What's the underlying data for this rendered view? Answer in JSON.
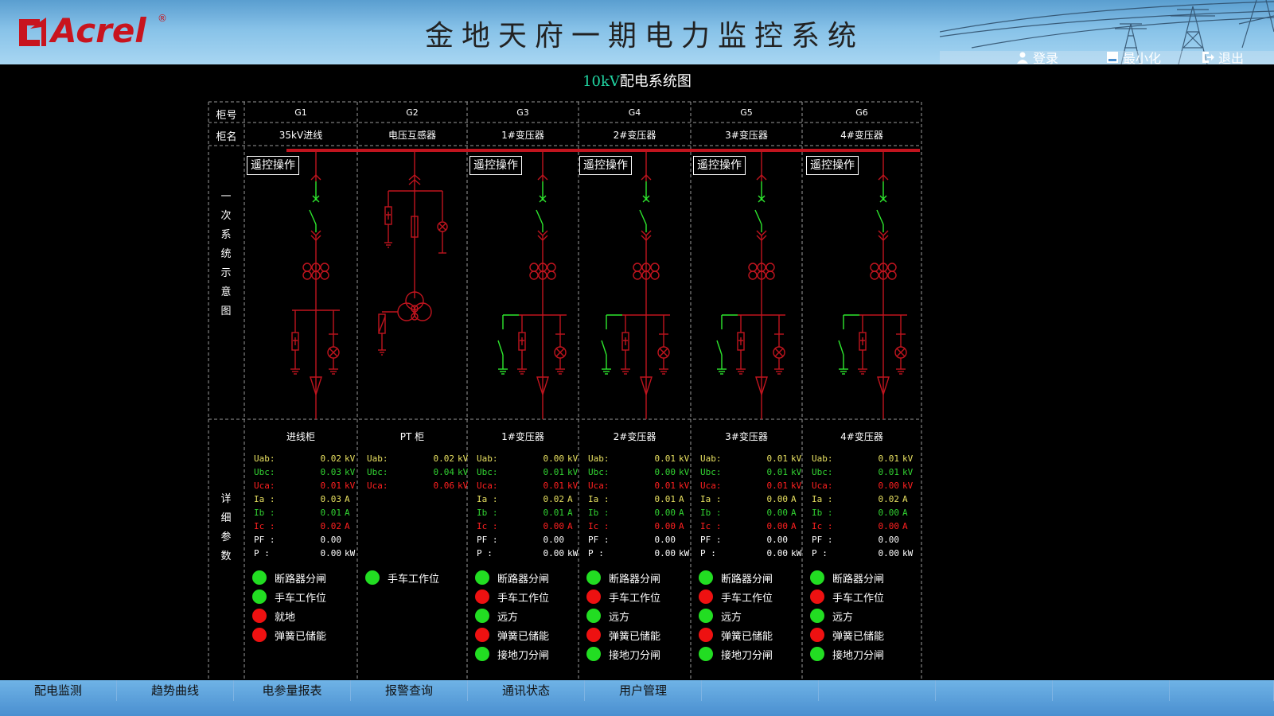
{
  "header": {
    "logo_text": "Acrel",
    "logo_mark": "®",
    "title": "金地天府一期电力监控系统",
    "buttons": [
      {
        "label": "登录",
        "icon": "user-icon"
      },
      {
        "label": "最小化",
        "icon": "minimize-icon"
      },
      {
        "label": "退出",
        "icon": "exit-icon"
      }
    ]
  },
  "diagram": {
    "title_prefix": "10kV",
    "title_suffix": "配电系统图",
    "row_label_no": "柜号",
    "row_label_name": "柜名",
    "section_primary": [
      "一",
      "次",
      "系",
      "统",
      "示",
      "意",
      "图"
    ],
    "section_detail": [
      "详",
      "细",
      "参",
      "数"
    ],
    "remote_button_label": "遥控操作"
  },
  "cabinets": [
    {
      "no": "G1",
      "name": "35kV进线",
      "panel_title": "进线柜",
      "remote": true,
      "params": [
        {
          "k": "Uab:",
          "v": "0.02",
          "u": "kV",
          "c": "#e8e060"
        },
        {
          "k": "Ubc:",
          "v": "0.03",
          "u": "kV",
          "c": "#32d232"
        },
        {
          "k": "Uca:",
          "v": "0.01",
          "u": "kV",
          "c": "#ff2020"
        },
        {
          "k": "Ia :",
          "v": "0.03",
          "u": "A",
          "c": "#e8e060"
        },
        {
          "k": "Ib :",
          "v": "0.01",
          "u": "A",
          "c": "#32d232"
        },
        {
          "k": "Ic :",
          "v": "0.02",
          "u": "A",
          "c": "#ff2020"
        },
        {
          "k": "PF :",
          "v": "0.00",
          "u": "",
          "c": "#ffffff"
        },
        {
          "k": "P  :",
          "v": "0.00",
          "u": "kW",
          "c": "#ffffff"
        }
      ],
      "status": [
        {
          "label": "断路器分闸",
          "color": "green"
        },
        {
          "label": "手车工作位",
          "color": "green"
        },
        {
          "label": "就地",
          "color": "red"
        },
        {
          "label": "弹簧已储能",
          "color": "red"
        }
      ]
    },
    {
      "no": "G2",
      "name": "电压互感器",
      "panel_title": "PT 柜",
      "remote": false,
      "params": [
        {
          "k": "Uab:",
          "v": "0.02",
          "u": "kV",
          "c": "#e8e060"
        },
        {
          "k": "Ubc:",
          "v": "0.04",
          "u": "kV",
          "c": "#32d232"
        },
        {
          "k": "Uca:",
          "v": "0.06",
          "u": "kV",
          "c": "#ff2020"
        }
      ],
      "status": [
        {
          "label": "手车工作位",
          "color": "green"
        }
      ]
    },
    {
      "no": "G3",
      "name": "1#变压器",
      "panel_title": "1#变压器",
      "remote": true,
      "params": [
        {
          "k": "Uab:",
          "v": "0.00",
          "u": "kV",
          "c": "#e8e060"
        },
        {
          "k": "Ubc:",
          "v": "0.01",
          "u": "kV",
          "c": "#32d232"
        },
        {
          "k": "Uca:",
          "v": "0.01",
          "u": "kV",
          "c": "#ff2020"
        },
        {
          "k": "Ia :",
          "v": "0.02",
          "u": "A",
          "c": "#e8e060"
        },
        {
          "k": "Ib :",
          "v": "0.01",
          "u": "A",
          "c": "#32d232"
        },
        {
          "k": "Ic :",
          "v": "0.00",
          "u": "A",
          "c": "#ff2020"
        },
        {
          "k": "PF :",
          "v": "0.00",
          "u": "",
          "c": "#ffffff"
        },
        {
          "k": "P  :",
          "v": "0.00",
          "u": "kW",
          "c": "#ffffff"
        }
      ],
      "status": [
        {
          "label": "断路器分闸",
          "color": "green"
        },
        {
          "label": "手车工作位",
          "color": "red"
        },
        {
          "label": "远方",
          "color": "green"
        },
        {
          "label": "弹簧已储能",
          "color": "red"
        },
        {
          "label": "接地刀分闸",
          "color": "green"
        }
      ]
    },
    {
      "no": "G4",
      "name": "2#变压器",
      "panel_title": "2#变压器",
      "remote": true,
      "params": [
        {
          "k": "Uab:",
          "v": "0.01",
          "u": "kV",
          "c": "#e8e060"
        },
        {
          "k": "Ubc:",
          "v": "0.00",
          "u": "kV",
          "c": "#32d232"
        },
        {
          "k": "Uca:",
          "v": "0.01",
          "u": "kV",
          "c": "#ff2020"
        },
        {
          "k": "Ia :",
          "v": "0.01",
          "u": "A",
          "c": "#e8e060"
        },
        {
          "k": "Ib :",
          "v": "0.00",
          "u": "A",
          "c": "#32d232"
        },
        {
          "k": "Ic :",
          "v": "0.00",
          "u": "A",
          "c": "#ff2020"
        },
        {
          "k": "PF :",
          "v": "0.00",
          "u": "",
          "c": "#ffffff"
        },
        {
          "k": "P  :",
          "v": "0.00",
          "u": "kW",
          "c": "#ffffff"
        }
      ],
      "status": [
        {
          "label": "断路器分闸",
          "color": "green"
        },
        {
          "label": "手车工作位",
          "color": "red"
        },
        {
          "label": "远方",
          "color": "green"
        },
        {
          "label": "弹簧已储能",
          "color": "red"
        },
        {
          "label": "接地刀分闸",
          "color": "green"
        }
      ]
    },
    {
      "no": "G5",
      "name": "3#变压器",
      "panel_title": "3#变压器",
      "remote": true,
      "params": [
        {
          "k": "Uab:",
          "v": "0.01",
          "u": "kV",
          "c": "#e8e060"
        },
        {
          "k": "Ubc:",
          "v": "0.01",
          "u": "kV",
          "c": "#32d232"
        },
        {
          "k": "Uca:",
          "v": "0.01",
          "u": "kV",
          "c": "#ff2020"
        },
        {
          "k": "Ia :",
          "v": "0.00",
          "u": "A",
          "c": "#e8e060"
        },
        {
          "k": "Ib :",
          "v": "0.00",
          "u": "A",
          "c": "#32d232"
        },
        {
          "k": "Ic :",
          "v": "0.00",
          "u": "A",
          "c": "#ff2020"
        },
        {
          "k": "PF :",
          "v": "0.00",
          "u": "",
          "c": "#ffffff"
        },
        {
          "k": "P  :",
          "v": "0.00",
          "u": "kW",
          "c": "#ffffff"
        }
      ],
      "status": [
        {
          "label": "断路器分闸",
          "color": "green"
        },
        {
          "label": "手车工作位",
          "color": "red"
        },
        {
          "label": "远方",
          "color": "green"
        },
        {
          "label": "弹簧已储能",
          "color": "red"
        },
        {
          "label": "接地刀分闸",
          "color": "green"
        }
      ]
    },
    {
      "no": "G6",
      "name": "4#变压器",
      "panel_title": "4#变压器",
      "remote": true,
      "params": [
        {
          "k": "Uab:",
          "v": "0.01",
          "u": "kV",
          "c": "#e8e060"
        },
        {
          "k": "Ubc:",
          "v": "0.01",
          "u": "kV",
          "c": "#32d232"
        },
        {
          "k": "Uca:",
          "v": "0.00",
          "u": "kV",
          "c": "#ff2020"
        },
        {
          "k": "Ia :",
          "v": "0.02",
          "u": "A",
          "c": "#e8e060"
        },
        {
          "k": "Ib :",
          "v": "0.00",
          "u": "A",
          "c": "#32d232"
        },
        {
          "k": "Ic :",
          "v": "0.00",
          "u": "A",
          "c": "#ff2020"
        },
        {
          "k": "PF :",
          "v": "0.00",
          "u": "",
          "c": "#ffffff"
        },
        {
          "k": "P  :",
          "v": "0.00",
          "u": "kW",
          "c": "#ffffff"
        }
      ],
      "status": [
        {
          "label": "断路器分闸",
          "color": "green"
        },
        {
          "label": "手车工作位",
          "color": "red"
        },
        {
          "label": "远方",
          "color": "green"
        },
        {
          "label": "弹簧已储能",
          "color": "red"
        },
        {
          "label": "接地刀分闸",
          "color": "green"
        }
      ]
    }
  ],
  "colors": {
    "bus": "#c0141e",
    "breaker_green": "#2ee82e",
    "dot_green": "#22dd22",
    "dot_red": "#ee1111",
    "grid": "#9a9a9a"
  },
  "navbar": {
    "items": [
      "配电监测",
      "趋势曲线",
      "电参量报表",
      "报警查询",
      "通讯状态",
      "用户管理",
      "",
      "",
      "",
      "",
      ""
    ]
  }
}
